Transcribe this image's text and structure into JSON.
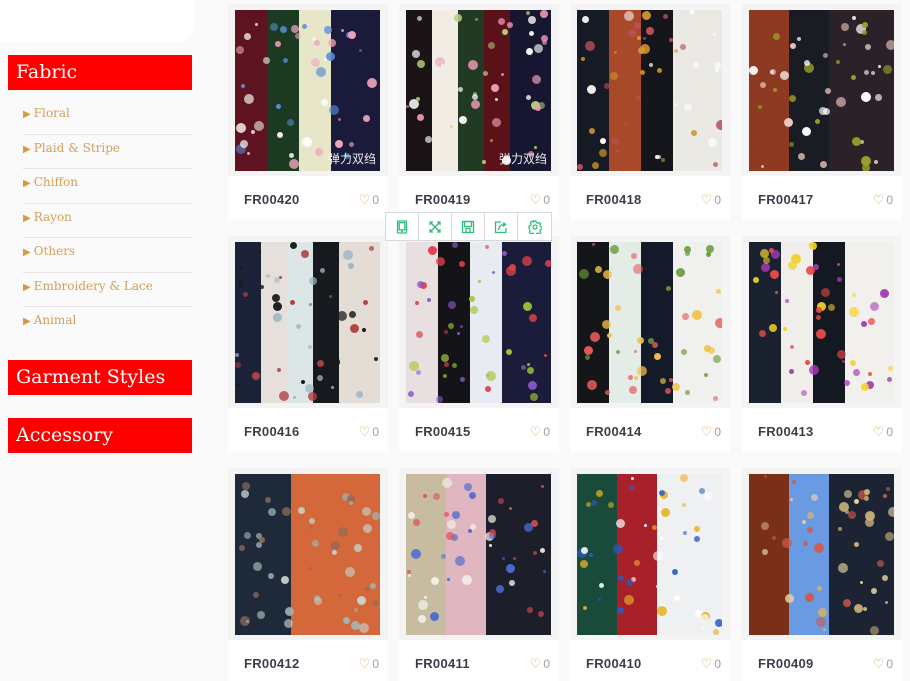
{
  "sidebar": {
    "categories": [
      {
        "label": "Fabric",
        "subcategories": [
          "Floral",
          "Plaid & Stripe",
          "Chiffon",
          "Rayon",
          "Others",
          "Embroidery & Lace",
          "Animal"
        ]
      },
      {
        "label": "Garment Styles",
        "subcategories": []
      },
      {
        "label": "Accessory",
        "subcategories": []
      }
    ],
    "arrow_glyph": "▶"
  },
  "toolbar": {
    "icons": [
      "tablet-icon",
      "fullscreen-icon",
      "save-icon",
      "share-icon",
      "settings-icon"
    ],
    "accent_color": "#2ebd7a"
  },
  "colors": {
    "category_header_bg": "#ff0000",
    "subcategory_text": "#d3a05c",
    "heart": "#d7a15e"
  },
  "products": [
    {
      "code": "FR00420",
      "likes": "0",
      "watermark": "弹力双绉",
      "palette": [
        "#5e1420",
        "#1c3a22",
        "#e8e6c8",
        "#1a1a3a"
      ],
      "accents": [
        "#f2a6c0",
        "#5a8fd6",
        "#ffffff"
      ]
    },
    {
      "code": "FR00419",
      "likes": "0",
      "watermark": "弹力双绉",
      "palette": [
        "#1a1416",
        "#f1ede4",
        "#223a24",
        "#5a1218",
        "#161630"
      ],
      "accents": [
        "#f09ab8",
        "#ffffff",
        "#b5d07a"
      ]
    },
    {
      "code": "FR00418",
      "likes": "0",
      "watermark": "",
      "palette": [
        "#151a24",
        "#a84a2a",
        "#14161c",
        "#ebe9e4"
      ],
      "accents": [
        "#c0505a",
        "#d4952e",
        "#ffffff"
      ]
    },
    {
      "code": "FR00417",
      "likes": "0",
      "watermark": "",
      "palette": [
        "#8e3a22",
        "#1a1c24",
        "#2a2228"
      ],
      "accents": [
        "#ffffff",
        "#eec6c0",
        "#9aa02a"
      ]
    },
    {
      "code": "FR00416",
      "likes": "0",
      "watermark": "",
      "palette": [
        "#1c2338",
        "#e6e0dc",
        "#dde6e6",
        "#161a1e",
        "#e3ddd6"
      ],
      "accents": [
        "#1a1a1a",
        "#9ab4c4",
        "#b04040"
      ]
    },
    {
      "code": "FR00415",
      "likes": "0",
      "watermark": "",
      "palette": [
        "#e8e0e0",
        "#141418",
        "#e8ecf2",
        "#1a1c3a"
      ],
      "accents": [
        "#e0404a",
        "#8a58c8",
        "#a6c83a"
      ]
    },
    {
      "code": "FR00414",
      "likes": "0",
      "watermark": "",
      "palette": [
        "#14161a",
        "#e4ece8",
        "#141a2a",
        "#f0f0ee"
      ],
      "accents": [
        "#e85a5a",
        "#6a9a3a",
        "#f2c24a"
      ]
    },
    {
      "code": "FR00413",
      "likes": "0",
      "watermark": "",
      "palette": [
        "#1a2230",
        "#f0eeea",
        "#141820",
        "#f2f0ec"
      ],
      "accents": [
        "#a43ab4",
        "#e84a4a",
        "#f2d02a"
      ]
    },
    {
      "code": "FR00412",
      "likes": "0",
      "watermark": "",
      "palette": [
        "#1e2a3a",
        "#d4683a"
      ],
      "accents": [
        "#a0b4b0",
        "#8a6a5a",
        "#c6d2cc"
      ]
    },
    {
      "code": "FR00411",
      "likes": "0",
      "watermark": "",
      "palette": [
        "#c8bca0",
        "#e0b6c0",
        "#1c1e2a"
      ],
      "accents": [
        "#4a6ad0",
        "#e04a5a",
        "#f2f0e4"
      ]
    },
    {
      "code": "FR00410",
      "likes": "0",
      "watermark": "",
      "palette": [
        "#1a4a3a",
        "#a8202a",
        "#eef0f2"
      ],
      "accents": [
        "#e8b42a",
        "#2a5ac8",
        "#ffffff"
      ]
    },
    {
      "code": "FR00409",
      "likes": "0",
      "watermark": "",
      "palette": [
        "#7a3018",
        "#6a9ae2",
        "#1c2434"
      ],
      "accents": [
        "#c8b078",
        "#d05a4a",
        "#e4d2a0"
      ]
    }
  ]
}
